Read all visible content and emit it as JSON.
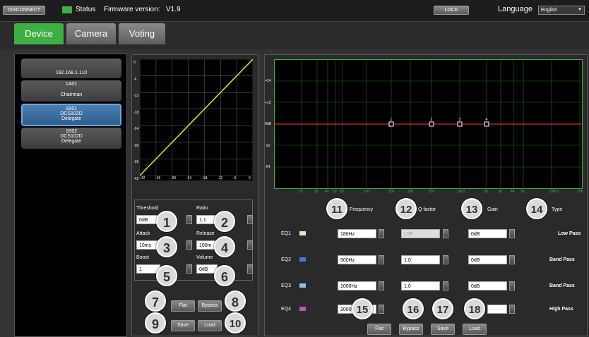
{
  "topbar": {
    "disconnect_label": "DISCONNECT",
    "status_label": "Status",
    "firmware_label": "Firmware version:",
    "firmware_value": "V1.9",
    "lock_label": "LOCK",
    "language_label": "Language",
    "language_value": "English"
  },
  "tabs": [
    {
      "label": "Device",
      "active": true
    },
    {
      "label": "Camera",
      "active": false
    },
    {
      "label": "Voting",
      "active": false
    }
  ],
  "devices": [
    {
      "line1": "",
      "line2": "192.168.1.110",
      "line3": ""
    },
    {
      "line1": "1A01",
      "line2": "",
      "line3": "Chairman"
    },
    {
      "line1": "1B01",
      "line2": "DCS102D",
      "line3": "Delegate",
      "selected": true
    },
    {
      "line1": "1B02",
      "line2": "DCS102D",
      "line3": "Delegate"
    }
  ],
  "compressor": {
    "y_ticks": [
      "0",
      "-6",
      "-12",
      "-18",
      "-24",
      "-30",
      "-36",
      "-42"
    ],
    "x_ticks": [
      "-42",
      "-36",
      "-30",
      "-24",
      "-18",
      "-12",
      "-6",
      "0"
    ],
    "threshold_label": "Threshold",
    "threshold_value": "0dB",
    "ratio_label": "Ratio",
    "ratio_value": "1:1",
    "attack_label": "Attack",
    "attack_value": "10ms",
    "release_label": "Release",
    "release_value": "100m",
    "boost_label": "Boost",
    "boost_value": "1",
    "volume_label": "Volume",
    "volume_value": "0dB",
    "flat_label": "Flat",
    "bypass_label": "Bypass",
    "save_label": "Save",
    "load_label": "Load"
  },
  "badges": [
    "1",
    "2",
    "3",
    "4",
    "5",
    "6",
    "7",
    "8",
    "9",
    "10",
    "11",
    "12",
    "13",
    "14",
    "15",
    "16",
    "17",
    "18"
  ],
  "eq": {
    "y_ticks": [
      "+24",
      "+12",
      "0dB",
      "-12",
      "-24"
    ],
    "x_ticks": [
      "20",
      "30",
      "40",
      "50",
      "60",
      "100",
      "200",
      "300",
      "500",
      "1kHz",
      "2K",
      "3K",
      "4K",
      "5K",
      "10kHz",
      "20K"
    ],
    "points": [
      "1",
      "2",
      "3",
      "4"
    ],
    "header": {
      "frequency": "Frequency",
      "q": "Q factor",
      "gain": "Gain",
      "type": "Type"
    },
    "rows": [
      {
        "label": "EQ1",
        "color": "#e8e8c8",
        "freq": "186Hz",
        "q": "LSF",
        "gain": "0dB",
        "type": "Low Pass"
      },
      {
        "label": "EQ2",
        "color": "#3a7fd5",
        "freq": "500Hz",
        "q": "1.0",
        "gain": "0dB",
        "type": "Band Pass"
      },
      {
        "label": "EQ3",
        "color": "#8ec0f0",
        "freq": "1000Hz",
        "q": "1.0",
        "gain": "0dB",
        "type": "Band Pass"
      },
      {
        "label": "EQ4",
        "color": "#c84fb8",
        "freq": "2000Hz",
        "q": "",
        "gain": "",
        "type": "High Pass"
      }
    ],
    "flat_label": "Flat",
    "bypass_label": "Bypass",
    "save_label": "Save",
    "load_label": "Load"
  },
  "colors": {
    "accent_green": "#3cb043",
    "status_green": "#3cb043",
    "curve_yellow": "#e6e600",
    "eq_line_red": "#e02020"
  }
}
